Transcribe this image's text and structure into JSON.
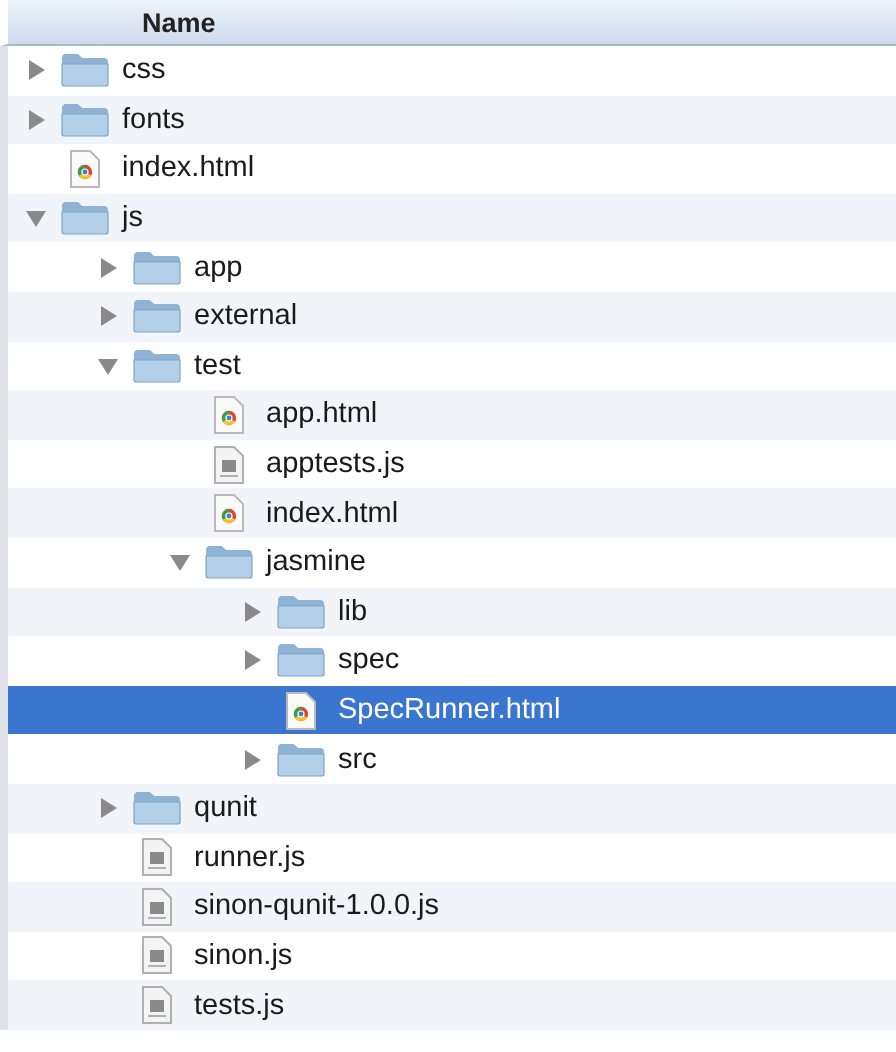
{
  "header": {
    "label": "Name"
  },
  "tree": [
    {
      "name": "css",
      "kind": "folder",
      "expanded": false,
      "selected": false
    },
    {
      "name": "fonts",
      "kind": "folder",
      "expanded": false,
      "selected": false
    },
    {
      "name": "index.html",
      "kind": "html",
      "selected": false
    },
    {
      "name": "js",
      "kind": "folder",
      "expanded": true,
      "selected": false,
      "children": [
        {
          "name": "app",
          "kind": "folder",
          "expanded": false,
          "selected": false
        },
        {
          "name": "external",
          "kind": "folder",
          "expanded": false,
          "selected": false
        },
        {
          "name": "test",
          "kind": "folder",
          "expanded": true,
          "selected": false,
          "children": [
            {
              "name": "app.html",
              "kind": "html",
              "selected": false
            },
            {
              "name": "apptests.js",
              "kind": "js",
              "selected": false
            },
            {
              "name": "index.html",
              "kind": "html",
              "selected": false
            },
            {
              "name": "jasmine",
              "kind": "folder",
              "expanded": true,
              "selected": false,
              "children": [
                {
                  "name": "lib",
                  "kind": "folder",
                  "expanded": false,
                  "selected": false
                },
                {
                  "name": "spec",
                  "kind": "folder",
                  "expanded": false,
                  "selected": false
                },
                {
                  "name": "SpecRunner.html",
                  "kind": "html",
                  "selected": true
                },
                {
                  "name": "src",
                  "kind": "folder",
                  "expanded": false,
                  "selected": false
                }
              ]
            }
          ]
        },
        {
          "name": "qunit",
          "kind": "folder",
          "expanded": false,
          "selected": false
        },
        {
          "name": "runner.js",
          "kind": "js",
          "selected": false
        },
        {
          "name": "sinon-qunit-1.0.0.js",
          "kind": "js",
          "selected": false
        },
        {
          "name": "sinon.js",
          "kind": "js",
          "selected": false
        },
        {
          "name": "tests.js",
          "kind": "js",
          "selected": false
        }
      ]
    }
  ]
}
